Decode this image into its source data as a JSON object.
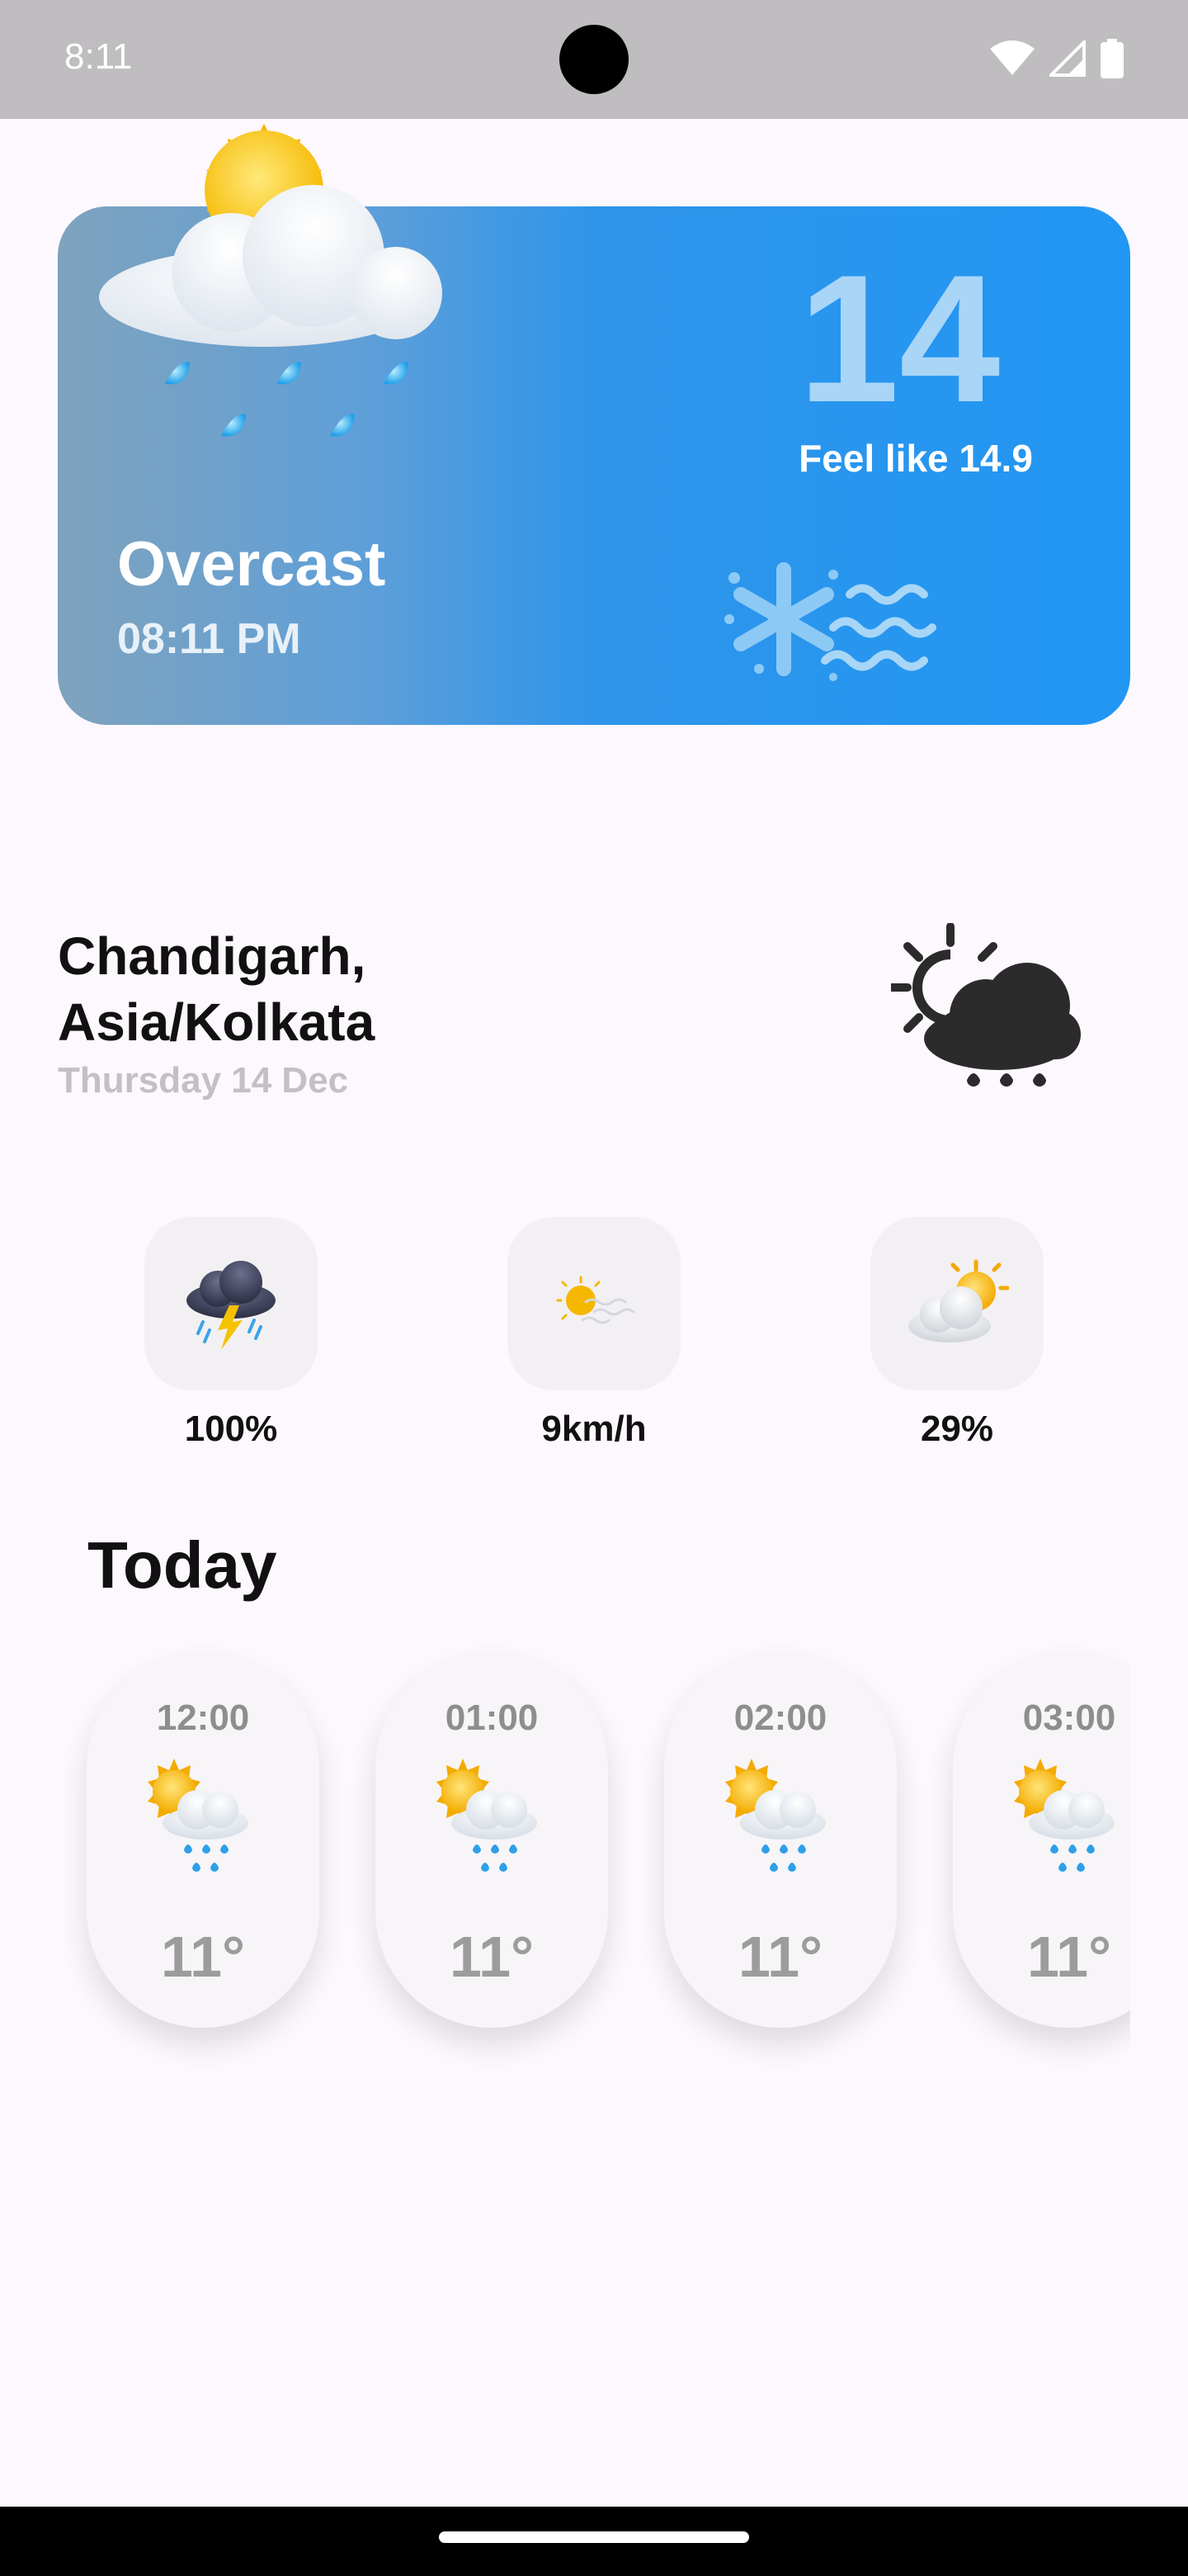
{
  "status_bar": {
    "time": "8:11",
    "icons": [
      "wifi-icon",
      "signal-icon",
      "battery-icon"
    ]
  },
  "hero": {
    "condition": "Overcast",
    "time": "08:11 PM",
    "temperature": "14",
    "feels_like": "Feel like 14.9",
    "gradient_start": "#7fa3bd",
    "gradient_end": "#2196f3",
    "art_icon": "sun-cloud-rain-icon",
    "wind_icon": "snow-wind-icon"
  },
  "location": {
    "city_line1": "Chandigarh,",
    "city_line2": "Asia/Kolkata",
    "date": "Thursday 14 Dec",
    "icon": "sun-cloud-rain-dark-icon"
  },
  "stats": [
    {
      "icon": "thunderstorm-icon",
      "value": "100%"
    },
    {
      "icon": "sun-wind-icon",
      "value": "9km/h"
    },
    {
      "icon": "partly-cloudy-icon",
      "value": "29%"
    }
  ],
  "today": {
    "title": "Today",
    "hours": [
      {
        "time": "12:00",
        "temp": "11°",
        "icon": "sun-cloud-rain-icon"
      },
      {
        "time": "01:00",
        "temp": "11°",
        "icon": "sun-cloud-rain-icon"
      },
      {
        "time": "02:00",
        "temp": "11°",
        "icon": "sun-cloud-rain-icon"
      },
      {
        "time": "03:00",
        "temp": "11°",
        "icon": "sun-cloud-rain-icon"
      }
    ]
  }
}
